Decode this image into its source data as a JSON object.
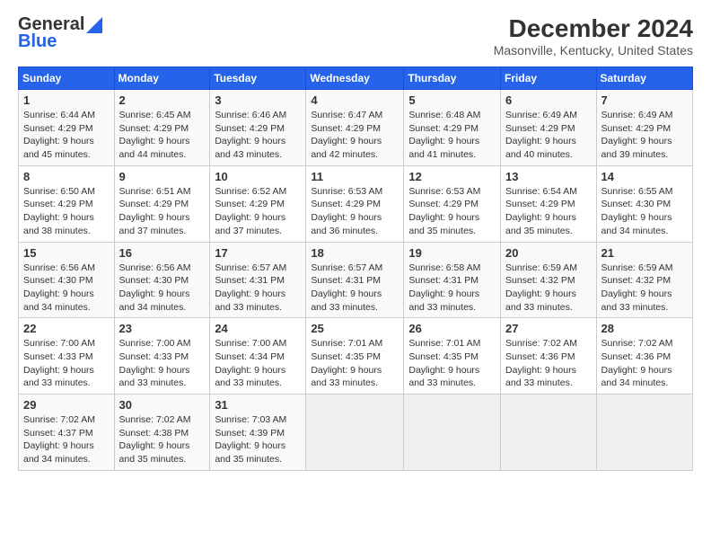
{
  "header": {
    "logo_line1": "General",
    "logo_line2": "Blue",
    "title": "December 2024",
    "subtitle": "Masonville, Kentucky, United States"
  },
  "weekdays": [
    "Sunday",
    "Monday",
    "Tuesday",
    "Wednesday",
    "Thursday",
    "Friday",
    "Saturday"
  ],
  "weeks": [
    [
      {
        "day": "1",
        "info": "Sunrise: 6:44 AM\nSunset: 4:29 PM\nDaylight: 9 hours\nand 45 minutes."
      },
      {
        "day": "2",
        "info": "Sunrise: 6:45 AM\nSunset: 4:29 PM\nDaylight: 9 hours\nand 44 minutes."
      },
      {
        "day": "3",
        "info": "Sunrise: 6:46 AM\nSunset: 4:29 PM\nDaylight: 9 hours\nand 43 minutes."
      },
      {
        "day": "4",
        "info": "Sunrise: 6:47 AM\nSunset: 4:29 PM\nDaylight: 9 hours\nand 42 minutes."
      },
      {
        "day": "5",
        "info": "Sunrise: 6:48 AM\nSunset: 4:29 PM\nDaylight: 9 hours\nand 41 minutes."
      },
      {
        "day": "6",
        "info": "Sunrise: 6:49 AM\nSunset: 4:29 PM\nDaylight: 9 hours\nand 40 minutes."
      },
      {
        "day": "7",
        "info": "Sunrise: 6:49 AM\nSunset: 4:29 PM\nDaylight: 9 hours\nand 39 minutes."
      }
    ],
    [
      {
        "day": "8",
        "info": "Sunrise: 6:50 AM\nSunset: 4:29 PM\nDaylight: 9 hours\nand 38 minutes."
      },
      {
        "day": "9",
        "info": "Sunrise: 6:51 AM\nSunset: 4:29 PM\nDaylight: 9 hours\nand 37 minutes."
      },
      {
        "day": "10",
        "info": "Sunrise: 6:52 AM\nSunset: 4:29 PM\nDaylight: 9 hours\nand 37 minutes."
      },
      {
        "day": "11",
        "info": "Sunrise: 6:53 AM\nSunset: 4:29 PM\nDaylight: 9 hours\nand 36 minutes."
      },
      {
        "day": "12",
        "info": "Sunrise: 6:53 AM\nSunset: 4:29 PM\nDaylight: 9 hours\nand 35 minutes."
      },
      {
        "day": "13",
        "info": "Sunrise: 6:54 AM\nSunset: 4:29 PM\nDaylight: 9 hours\nand 35 minutes."
      },
      {
        "day": "14",
        "info": "Sunrise: 6:55 AM\nSunset: 4:30 PM\nDaylight: 9 hours\nand 34 minutes."
      }
    ],
    [
      {
        "day": "15",
        "info": "Sunrise: 6:56 AM\nSunset: 4:30 PM\nDaylight: 9 hours\nand 34 minutes."
      },
      {
        "day": "16",
        "info": "Sunrise: 6:56 AM\nSunset: 4:30 PM\nDaylight: 9 hours\nand 34 minutes."
      },
      {
        "day": "17",
        "info": "Sunrise: 6:57 AM\nSunset: 4:31 PM\nDaylight: 9 hours\nand 33 minutes."
      },
      {
        "day": "18",
        "info": "Sunrise: 6:57 AM\nSunset: 4:31 PM\nDaylight: 9 hours\nand 33 minutes."
      },
      {
        "day": "19",
        "info": "Sunrise: 6:58 AM\nSunset: 4:31 PM\nDaylight: 9 hours\nand 33 minutes."
      },
      {
        "day": "20",
        "info": "Sunrise: 6:59 AM\nSunset: 4:32 PM\nDaylight: 9 hours\nand 33 minutes."
      },
      {
        "day": "21",
        "info": "Sunrise: 6:59 AM\nSunset: 4:32 PM\nDaylight: 9 hours\nand 33 minutes."
      }
    ],
    [
      {
        "day": "22",
        "info": "Sunrise: 7:00 AM\nSunset: 4:33 PM\nDaylight: 9 hours\nand 33 minutes."
      },
      {
        "day": "23",
        "info": "Sunrise: 7:00 AM\nSunset: 4:33 PM\nDaylight: 9 hours\nand 33 minutes."
      },
      {
        "day": "24",
        "info": "Sunrise: 7:00 AM\nSunset: 4:34 PM\nDaylight: 9 hours\nand 33 minutes."
      },
      {
        "day": "25",
        "info": "Sunrise: 7:01 AM\nSunset: 4:35 PM\nDaylight: 9 hours\nand 33 minutes."
      },
      {
        "day": "26",
        "info": "Sunrise: 7:01 AM\nSunset: 4:35 PM\nDaylight: 9 hours\nand 33 minutes."
      },
      {
        "day": "27",
        "info": "Sunrise: 7:02 AM\nSunset: 4:36 PM\nDaylight: 9 hours\nand 33 minutes."
      },
      {
        "day": "28",
        "info": "Sunrise: 7:02 AM\nSunset: 4:36 PM\nDaylight: 9 hours\nand 34 minutes."
      }
    ],
    [
      {
        "day": "29",
        "info": "Sunrise: 7:02 AM\nSunset: 4:37 PM\nDaylight: 9 hours\nand 34 minutes."
      },
      {
        "day": "30",
        "info": "Sunrise: 7:02 AM\nSunset: 4:38 PM\nDaylight: 9 hours\nand 35 minutes."
      },
      {
        "day": "31",
        "info": "Sunrise: 7:03 AM\nSunset: 4:39 PM\nDaylight: 9 hours\nand 35 minutes."
      },
      null,
      null,
      null,
      null
    ]
  ]
}
